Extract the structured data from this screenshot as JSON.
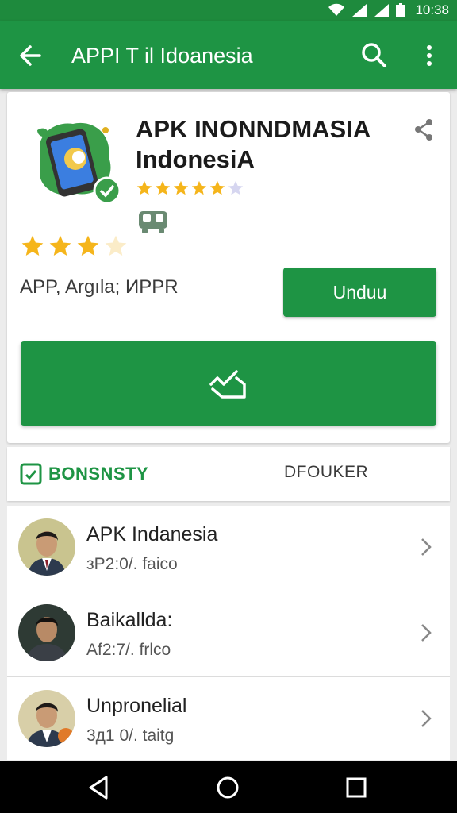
{
  "status_bar": {
    "time": "10:38"
  },
  "app_bar": {
    "title": "APPI T il Idoanesia"
  },
  "app": {
    "name_line1": "APK INONNDMASIA",
    "name_line2": "IndonesiA",
    "small_rating": 4.5,
    "big_rating": 3,
    "meta": "APP, Argıla; ИPPR",
    "download_label": "Unduu"
  },
  "tabs": {
    "active_label": "BONSNSTY",
    "other_label": "DFOUKER"
  },
  "list": [
    {
      "title": "APK Indanesia",
      "subtitle": "зP2:0/. faico"
    },
    {
      "title": "Baikallda:",
      "subtitle": "Af2:7/. frlco"
    },
    {
      "title": "Unpronelial",
      "subtitle": "3д1 0/. taitg"
    }
  ],
  "colors": {
    "primary": "#1e9444",
    "status_bar": "#1e8a3d",
    "star": "#f5b51b"
  }
}
